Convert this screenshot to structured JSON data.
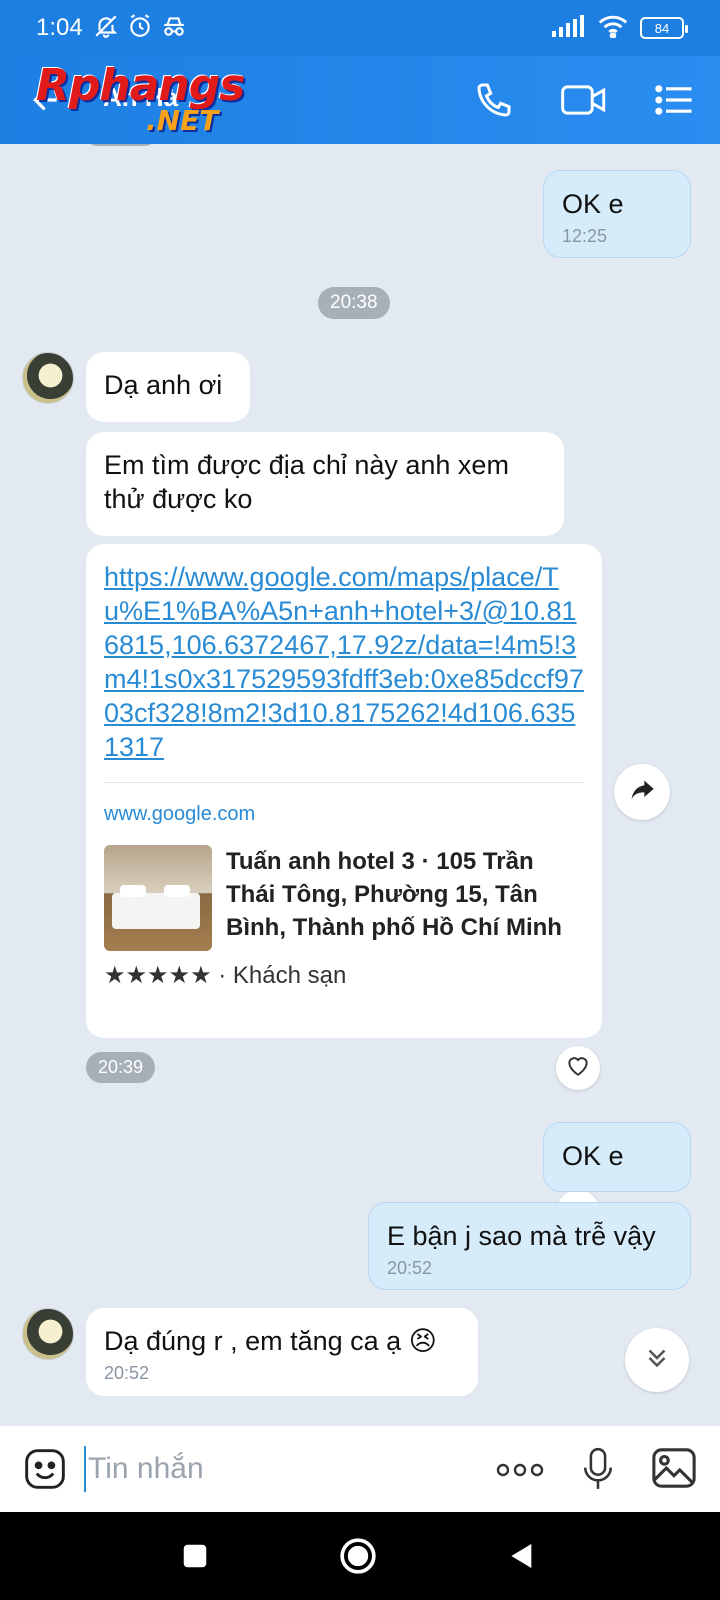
{
  "status_bar": {
    "time": "1:04",
    "battery": "84"
  },
  "header": {
    "contact_name": "An Hà",
    "watermark_main": "Rphangs",
    "watermark_net": ".NET"
  },
  "messages": {
    "m1": {
      "text": "OK e",
      "time": "12:25"
    },
    "sep1": "20:38",
    "m2": {
      "text": "Dạ anh ơi"
    },
    "m3": {
      "text": "Em tìm được địa chỉ này anh xem thử được ko"
    },
    "m4": {
      "url": "https://www.google.com/maps/place/Tu%E1%BA%A5n+anh+hotel+3/@10.816815,106.6372467,17.92z/data=!4m5!3m4!1s0x317529593fdff3eb:0xe85dccf9703cf328!8m2!3d10.8175262!4d106.6351317",
      "domain": "www.google.com",
      "title": "Tuấn anh hotel 3 · 105 Trần Thái Tông, Phường 15, Tân Bình, Thành phố Hồ Chí Minh",
      "stars": "★★★★★",
      "meta": " · Khách sạn"
    },
    "time_pill": "20:39",
    "m5": {
      "text": "OK e"
    },
    "m6": {
      "text": "E bận j sao mà trễ vậy",
      "time": "20:52"
    },
    "m7": {
      "text": "Dạ đúng r , em tăng ca ạ",
      "emoji": "😣",
      "time": "20:52"
    }
  },
  "input": {
    "placeholder": "Tin nhắn"
  },
  "colors": {
    "header_blue": "#1e7fe3",
    "link_blue": "#2a8bd5",
    "outgoing_bubble": "#d6ecfb",
    "chat_background": "#e2e9f1"
  },
  "icons": [
    "mute-icon",
    "alarm-icon",
    "incognito-icon",
    "signal-icon",
    "wifi-icon",
    "battery-icon",
    "back-arrow-icon",
    "phone-icon",
    "video-call-icon",
    "menu-list-icon",
    "share-forward-icon",
    "heart-icon",
    "scroll-down-icon",
    "emoji-sticker-icon",
    "more-dots-icon",
    "microphone-icon",
    "image-gallery-icon",
    "nav-square-icon",
    "nav-home-icon",
    "nav-back-icon"
  ]
}
